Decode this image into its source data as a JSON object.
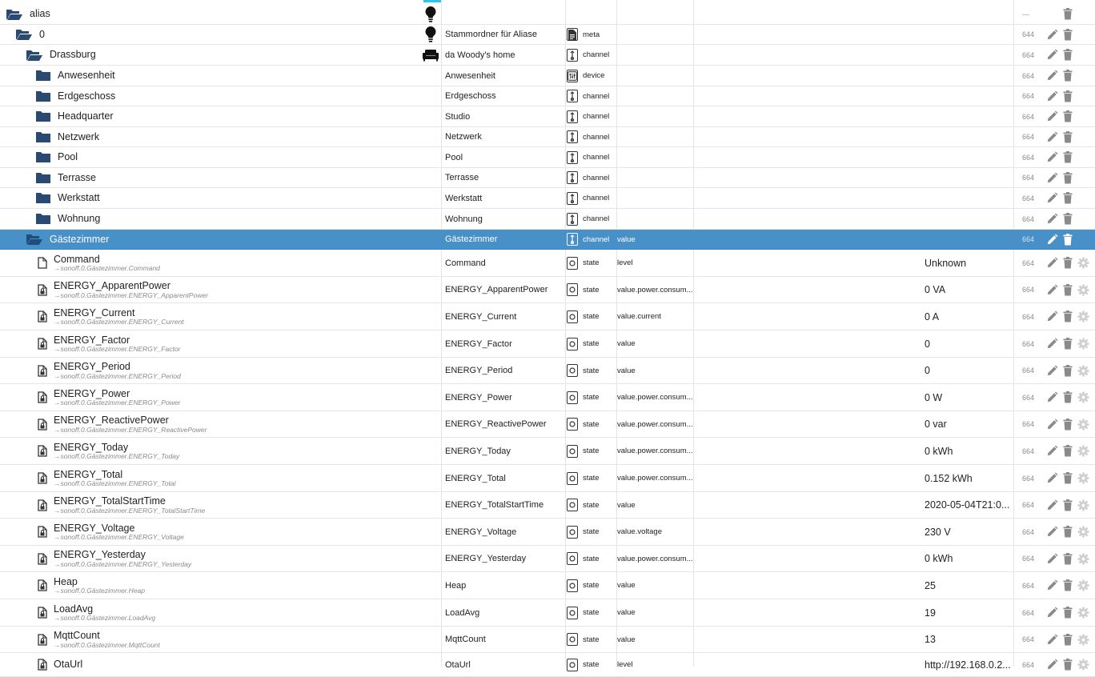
{
  "colors": {
    "selected_row": "#4890c8",
    "folder_icon": "#2b4a73",
    "top_marker": "#2ec4ec"
  },
  "top_acl": "---",
  "rows": [
    {
      "name": "alias",
      "level": 0,
      "icon": "folder-open-icon",
      "role_icon": "lightbulb-icon",
      "acl": ""
    },
    {
      "name": "0",
      "level": 1,
      "icon": "folder-open-icon",
      "role_icon": "lightbulb-icon",
      "desc": "Stammordner für Aliase",
      "type_icon": "meta-icon",
      "type": "meta",
      "acl": "644"
    },
    {
      "name": "Drassburg",
      "level": 2,
      "icon": "folder-open-icon",
      "role_icon": "sofa-icon",
      "desc": "da Woody's home",
      "type_icon": "channel-icon",
      "type": "channel",
      "acl": "664"
    },
    {
      "name": "Anwesenheit",
      "level": 3,
      "icon": "folder-closed-icon",
      "desc": "Anwesenheit",
      "type_icon": "device-icon",
      "type": "device",
      "acl": "664"
    },
    {
      "name": "Erdgeschoss",
      "level": 3,
      "icon": "folder-closed-icon",
      "desc": "Erdgeschoss",
      "type_icon": "channel-icon",
      "type": "channel",
      "acl": "664"
    },
    {
      "name": "Headquarter",
      "level": 3,
      "icon": "folder-closed-icon",
      "desc": "Studio",
      "type_icon": "channel-icon",
      "type": "channel",
      "acl": "664"
    },
    {
      "name": "Netzwerk",
      "level": 3,
      "icon": "folder-closed-icon",
      "desc": "Netzwerk",
      "type_icon": "channel-icon",
      "type": "channel",
      "acl": "664"
    },
    {
      "name": "Pool",
      "level": 3,
      "icon": "folder-closed-icon",
      "desc": "Pool",
      "type_icon": "channel-icon",
      "type": "channel",
      "acl": "664"
    },
    {
      "name": "Terrasse",
      "level": 3,
      "icon": "folder-closed-icon",
      "desc": "Terrasse",
      "type_icon": "channel-icon",
      "type": "channel",
      "acl": "664"
    },
    {
      "name": "Werkstatt",
      "level": 3,
      "icon": "folder-closed-icon",
      "desc": "Werkstatt",
      "type_icon": "channel-icon",
      "type": "channel",
      "acl": "664"
    },
    {
      "name": "Wohnung",
      "level": 3,
      "icon": "folder-closed-icon",
      "desc": "Wohnung",
      "type_icon": "channel-icon",
      "type": "channel",
      "acl": "664"
    },
    {
      "name": "Gästezimmer",
      "level": 2,
      "icon": "folder-open-icon",
      "desc": "Gästezimmer",
      "type_icon": "channel-icon",
      "type": "channel",
      "role": "value",
      "acl": "664",
      "selected": true
    },
    {
      "name": "Command",
      "alias": "→sonoff.0.Gästezimmer.Command",
      "level": 4,
      "icon": "file-icon",
      "desc": "Command",
      "type_icon": "state-icon",
      "type": "state",
      "role": "level",
      "value": "Unknown",
      "acl": "664",
      "gear": true
    },
    {
      "name": "ENERGY_ApparentPower",
      "alias": "→sonoff.0.Gästezimmer.ENERGY_ApparentPower",
      "level": 4,
      "icon": "file-lock-icon",
      "desc": "ENERGY_ApparentPower",
      "type_icon": "state-icon",
      "type": "state",
      "role": "value.power.consum...",
      "value": "0 VA",
      "acl": "664",
      "gear": true
    },
    {
      "name": "ENERGY_Current",
      "alias": "→sonoff.0.Gästezimmer.ENERGY_Current",
      "level": 4,
      "icon": "file-lock-icon",
      "desc": "ENERGY_Current",
      "type_icon": "state-icon",
      "type": "state",
      "role": "value.current",
      "value": "0 A",
      "acl": "664",
      "gear": true
    },
    {
      "name": "ENERGY_Factor",
      "alias": "→sonoff.0.Gästezimmer.ENERGY_Factor",
      "level": 4,
      "icon": "file-lock-icon",
      "desc": "ENERGY_Factor",
      "type_icon": "state-icon",
      "type": "state",
      "role": "value",
      "value": "0",
      "acl": "664",
      "gear": true
    },
    {
      "name": "ENERGY_Period",
      "alias": "→sonoff.0.Gästezimmer.ENERGY_Period",
      "level": 4,
      "icon": "file-lock-icon",
      "desc": "ENERGY_Period",
      "type_icon": "state-icon",
      "type": "state",
      "role": "value",
      "value": "0",
      "acl": "664",
      "gear": true
    },
    {
      "name": "ENERGY_Power",
      "alias": "→sonoff.0.Gästezimmer.ENERGY_Power",
      "level": 4,
      "icon": "file-lock-icon",
      "desc": "ENERGY_Power",
      "type_icon": "state-icon",
      "type": "state",
      "role": "value.power.consum...",
      "value": "0 W",
      "acl": "664",
      "gear": true
    },
    {
      "name": "ENERGY_ReactivePower",
      "alias": "→sonoff.0.Gästezimmer.ENERGY_ReactivePower",
      "level": 4,
      "icon": "file-lock-icon",
      "desc": "ENERGY_ReactivePower",
      "type_icon": "state-icon",
      "type": "state",
      "role": "value.power.consum...",
      "value": "0 var",
      "acl": "664",
      "gear": true
    },
    {
      "name": "ENERGY_Today",
      "alias": "→sonoff.0.Gästezimmer.ENERGY_Today",
      "level": 4,
      "icon": "file-lock-icon",
      "desc": "ENERGY_Today",
      "type_icon": "state-icon",
      "type": "state",
      "role": "value.power.consum...",
      "value": "0 kWh",
      "acl": "664",
      "gear": true
    },
    {
      "name": "ENERGY_Total",
      "alias": "→sonoff.0.Gästezimmer.ENERGY_Total",
      "level": 4,
      "icon": "file-lock-icon",
      "desc": "ENERGY_Total",
      "type_icon": "state-icon",
      "type": "state",
      "role": "value.power.consum...",
      "value": "0.152 kWh",
      "acl": "664",
      "gear": true
    },
    {
      "name": "ENERGY_TotalStartTime",
      "alias": "→sonoff.0.Gästezimmer.ENERGY_TotalStartTime",
      "level": 4,
      "icon": "file-lock-icon",
      "desc": "ENERGY_TotalStartTime",
      "type_icon": "state-icon",
      "type": "state",
      "role": "value",
      "value": "2020-05-04T21:0...",
      "acl": "664",
      "gear": true
    },
    {
      "name": "ENERGY_Voltage",
      "alias": "→sonoff.0.Gästezimmer.ENERGY_Voltage",
      "level": 4,
      "icon": "file-lock-icon",
      "desc": "ENERGY_Voltage",
      "type_icon": "state-icon",
      "type": "state",
      "role": "value.voltage",
      "value": "230 V",
      "acl": "664",
      "gear": true
    },
    {
      "name": "ENERGY_Yesterday",
      "alias": "→sonoff.0.Gästezimmer.ENERGY_Yesterday",
      "level": 4,
      "icon": "file-lock-icon",
      "desc": "ENERGY_Yesterday",
      "type_icon": "state-icon",
      "type": "state",
      "role": "value.power.consum...",
      "value": "0 kWh",
      "acl": "664",
      "gear": true
    },
    {
      "name": "Heap",
      "alias": "→sonoff.0.Gästezimmer.Heap",
      "level": 4,
      "icon": "file-lock-icon",
      "desc": "Heap",
      "type_icon": "state-icon",
      "type": "state",
      "role": "value",
      "value": "25",
      "acl": "664",
      "gear": true
    },
    {
      "name": "LoadAvg",
      "alias": "→sonoff.0.Gästezimmer.LoadAvg",
      "level": 4,
      "icon": "file-lock-icon",
      "desc": "LoadAvg",
      "type_icon": "state-icon",
      "type": "state",
      "role": "value",
      "value": "19",
      "acl": "664",
      "gear": true
    },
    {
      "name": "MqttCount",
      "alias": "→sonoff.0.Gästezimmer.MqttCount",
      "level": 4,
      "icon": "file-lock-icon",
      "desc": "MqttCount",
      "type_icon": "state-icon",
      "type": "state",
      "role": "value",
      "value": "13",
      "acl": "664",
      "gear": true
    },
    {
      "name": "OtaUrl",
      "level": 4,
      "icon": "file-lock-icon",
      "desc": "OtaUrl",
      "type_icon": "state-icon",
      "type": "state",
      "role": "level",
      "value": "http://192.168.0.2...",
      "acl": "664",
      "gear": true
    }
  ]
}
